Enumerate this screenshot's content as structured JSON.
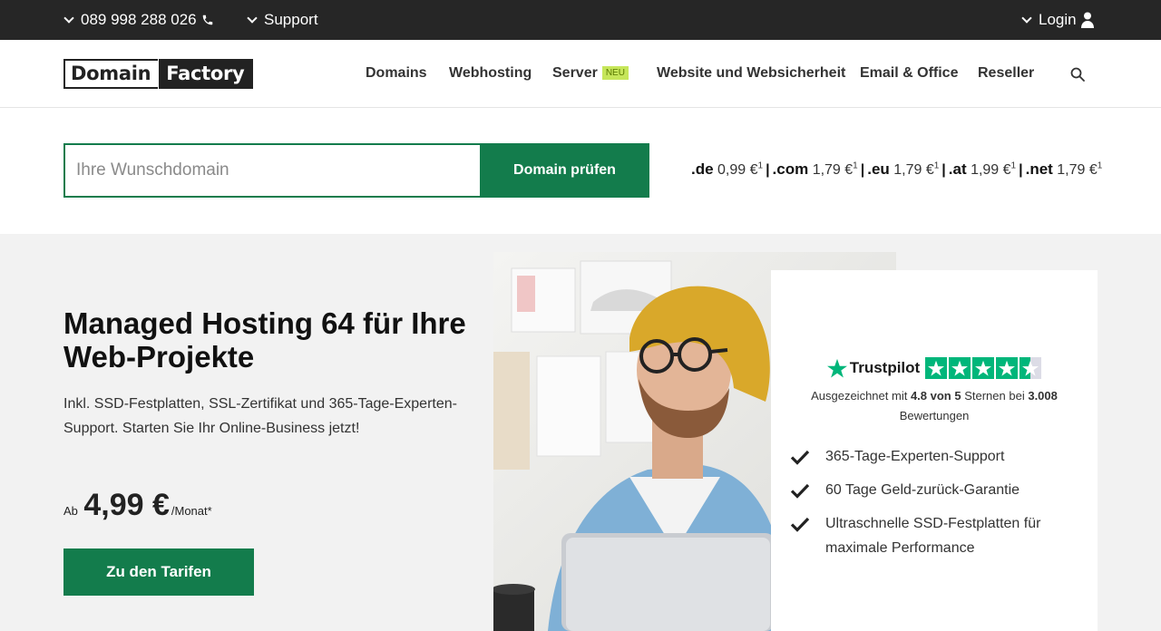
{
  "topbar": {
    "phone": "089 998 288 026",
    "support": "Support",
    "login": "Login"
  },
  "logo": {
    "part1": "Domain",
    "part2": "Factory"
  },
  "nav": {
    "items": [
      "Domains",
      "Webhosting",
      "Server",
      "Website und Websicherheit",
      "Email & Office",
      "Reseller"
    ],
    "server_badge": "NEU"
  },
  "domain_search": {
    "placeholder": "Ihre Wunschdomain",
    "button": "Domain prüfen"
  },
  "tld_prices": [
    {
      "tld": ".de",
      "price": "0,99 €",
      "note": "1"
    },
    {
      "tld": ".com",
      "price": "1,79 €",
      "note": "1"
    },
    {
      "tld": ".eu",
      "price": "1,79 €",
      "note": "1"
    },
    {
      "tld": ".at",
      "price": "1,99 €",
      "note": "1"
    },
    {
      "tld": ".net",
      "price": "1,79 €",
      "note": "1"
    }
  ],
  "hero": {
    "title": "Managed Hosting 64 für Ihre Web-Projekte",
    "subtitle": "Inkl. SSD-Festplatten, SSL-Zertifikat und 365-Tage-Experten-Support. Starten Sie Ihr Online-Business jetzt!",
    "price_prefix": "Ab",
    "price": "4,99 €",
    "price_suffix": "/Monat*",
    "cta": "Zu den Tarifen"
  },
  "trust": {
    "brand": "Trustpilot",
    "rating": 4.5,
    "text_prefix": "Ausgezeichnet mit",
    "score": "4.8 von 5",
    "text_mid": "Sternen bei",
    "count": "3.008",
    "text_suffix": "Bewertungen"
  },
  "features": [
    "365-Tage-Experten-Support",
    "60 Tage Geld-zurück-Garantie",
    "Ultraschnelle SSD-Festplatten für maximale Performance"
  ],
  "colors": {
    "brand_green": "#137c4c",
    "trustpilot_green": "#00b67a",
    "badge_lime": "#c6e65a",
    "topbar": "#262626"
  }
}
